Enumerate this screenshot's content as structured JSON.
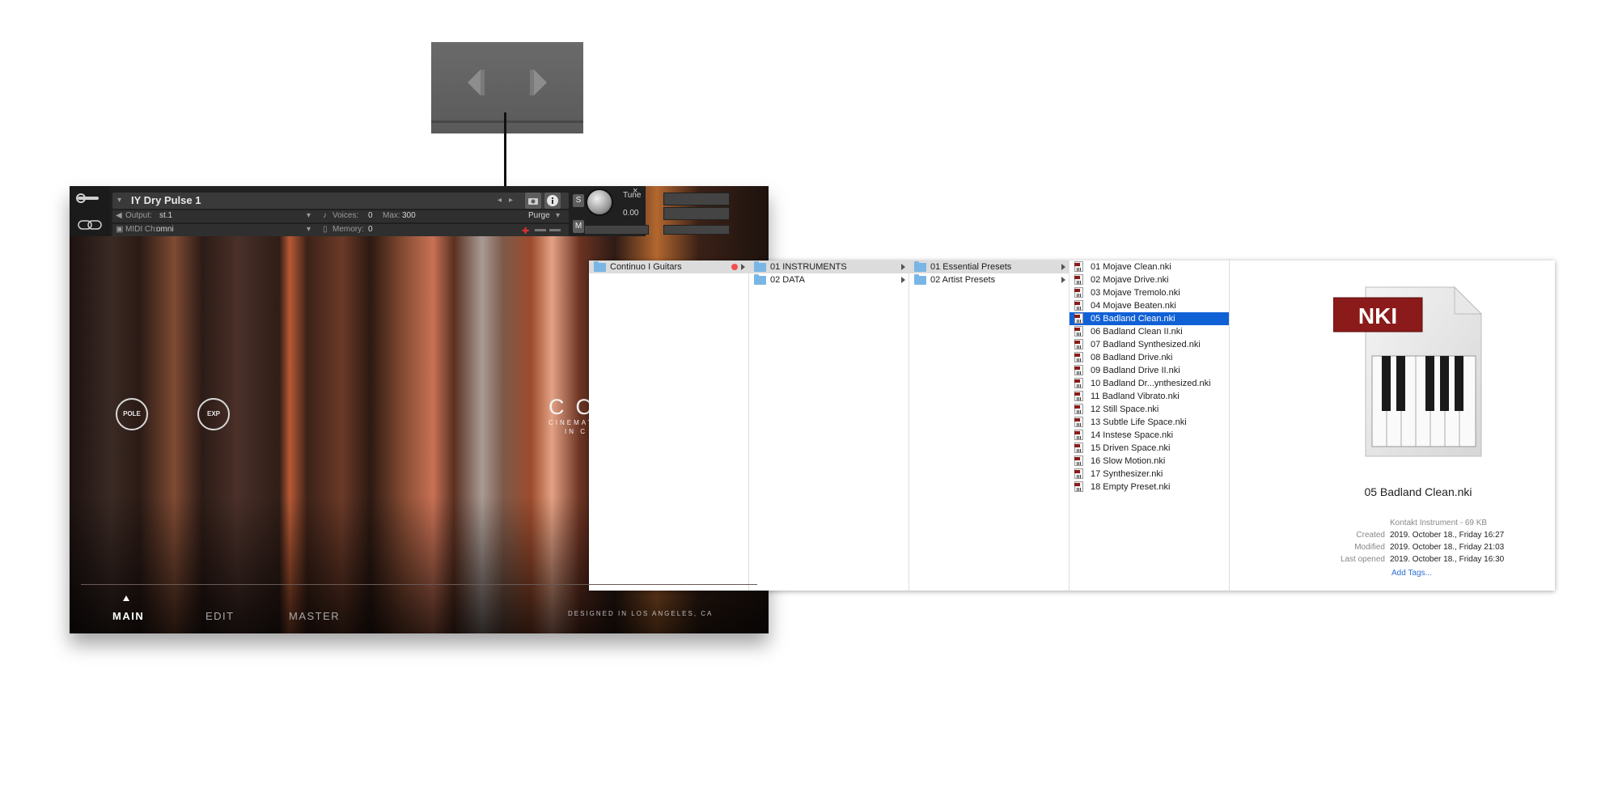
{
  "kontakt": {
    "instrument_name": "IY Dry Pulse 1",
    "output_label": "Output:",
    "output_value": "st.1",
    "voices_label": "Voices:",
    "voices_value": "0",
    "max_label": "Max:",
    "max_value": "300",
    "purge_label": "Purge",
    "midi_label": "MIDI Ch:",
    "midi_value": "omni",
    "memory_label": "Memory:",
    "memory_value": "0",
    "tune_label": "Tune",
    "tune_value": "0.00",
    "s_button": "S",
    "m_button": "M",
    "knob_pole": "POLE",
    "knob_exp": "EXP",
    "brand_title": "CO",
    "brand_line1": "CINEMAT",
    "brand_line2": "IN C",
    "tabs": [
      "MAIN",
      "EDIT",
      "MASTER"
    ],
    "designed": "DESIGNED IN LOS ANGELES, CA"
  },
  "finder": {
    "col1": [
      "Continuo I Guitars"
    ],
    "col2": [
      "01 INSTRUMENTS",
      "02 DATA"
    ],
    "col3": [
      "01 Essential Presets",
      "02 Artist Presets"
    ],
    "files": [
      "01 Mojave Clean.nki",
      "02 Mojave Drive.nki",
      "03 Mojave Tremolo.nki",
      "04 Mojave Beaten.nki",
      "05 Badland Clean.nki",
      "06 Badland Clean II.nki",
      "07 Badland Synthesized.nki",
      "08 Badland Drive.nki",
      "09 Badland Drive II.nki",
      "10 Badland Dr...ynthesized.nki",
      "11 Badland Vibrato.nki",
      "12 Still Space.nki",
      "13 Subtle Life Space.nki",
      "14 Instese Space.nki",
      "15 Driven Space.nki",
      "16 Slow Motion.nki",
      "17 Synthesizer.nki",
      "18 Empty Preset.nki"
    ],
    "selected_index": 4,
    "preview": {
      "badge": "NKI",
      "name": "05 Badland Clean.nki",
      "kind": "Kontakt Instrument - 69 KB",
      "created_label": "Created",
      "created": "2019. October 18., Friday 16:27",
      "modified_label": "Modified",
      "modified": "2019. October 18., Friday 21:03",
      "opened_label": "Last opened",
      "opened": "2019. October 18., Friday 16:30",
      "add_tags": "Add Tags..."
    }
  },
  "colors": {
    "selection_blue": "#1161d6",
    "folder_blue": "#79b6e6",
    "tag_red": "#f15050",
    "nki_badge": "#8b1a1a"
  }
}
